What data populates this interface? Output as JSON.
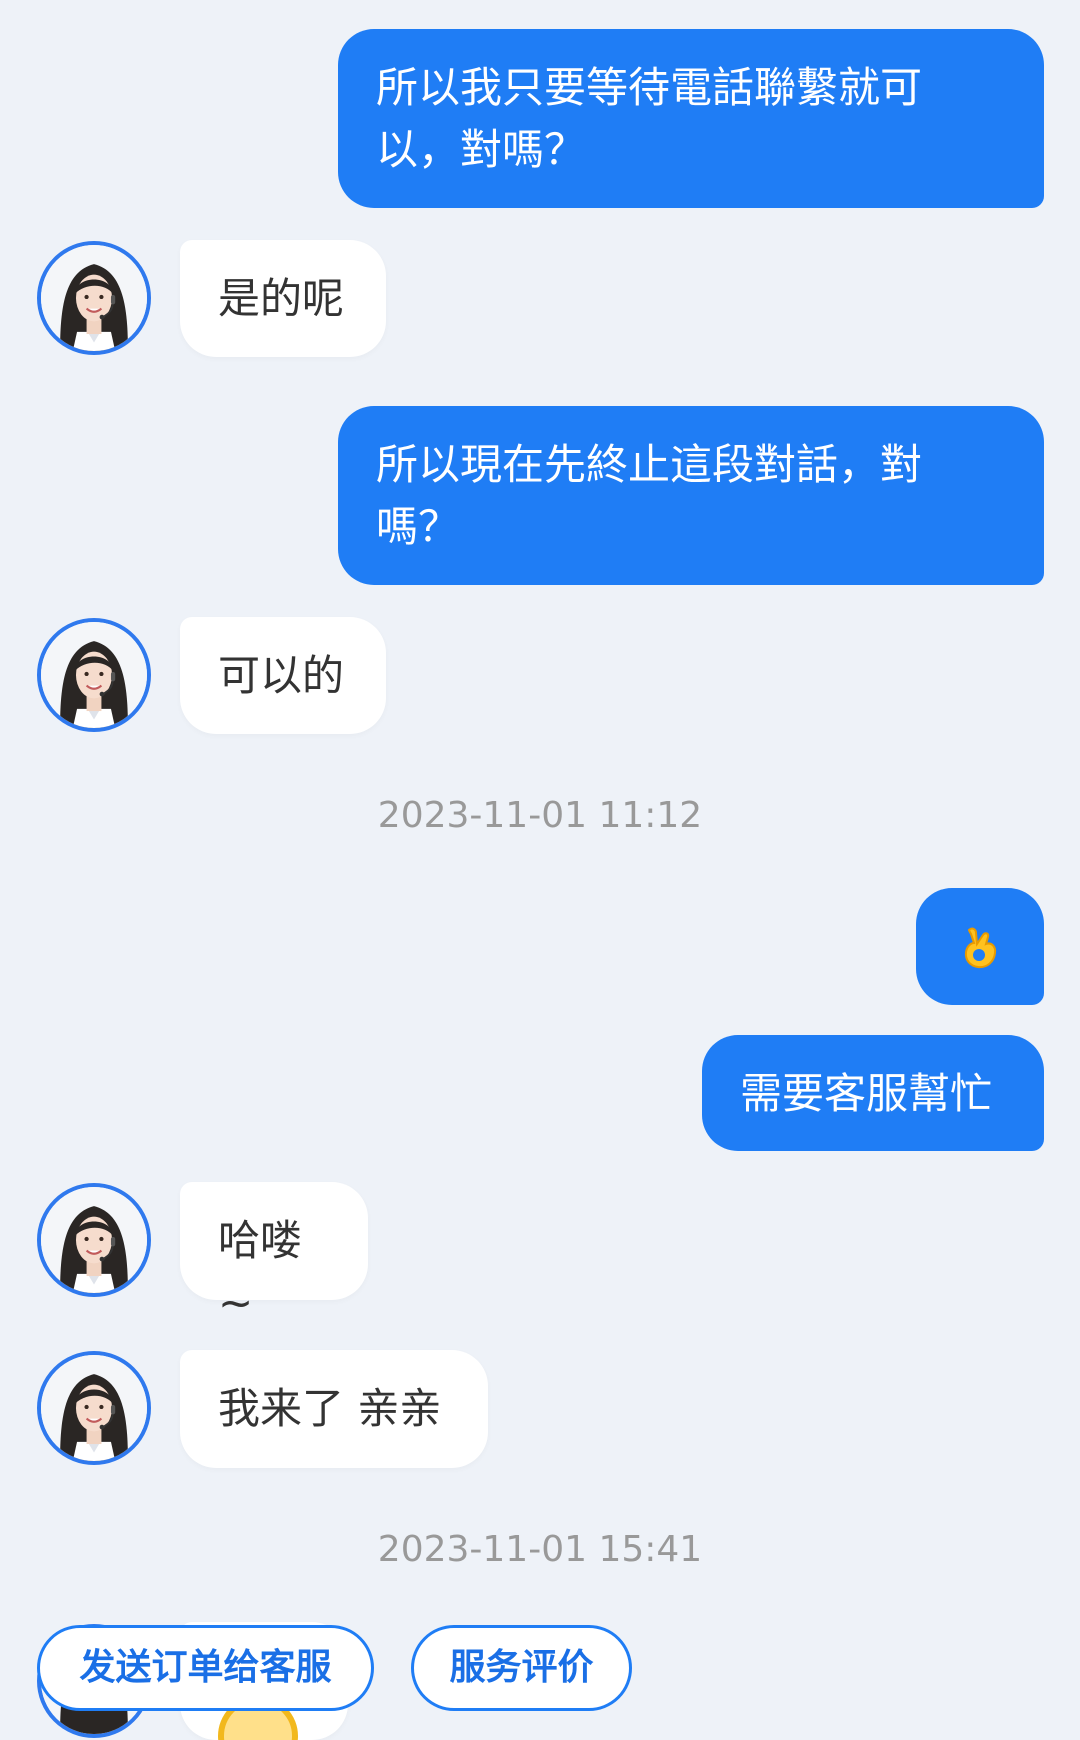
{
  "messages": [
    {
      "dir": "out",
      "text": "所以我只要等待電話聯繫就可以，對嗎？"
    },
    {
      "dir": "in",
      "text": "是的呢"
    },
    {
      "dir": "out",
      "text": "所以現在先終止這段對話，對嗎？"
    },
    {
      "dir": "in",
      "text": "可以的"
    },
    {
      "dir": "out",
      "icon": "ok-hand-emoji-icon"
    },
    {
      "dir": "out",
      "text": "需要客服幫忙"
    },
    {
      "dir": "in",
      "text": "哈喽~"
    },
    {
      "dir": "in",
      "text": "我来了 亲亲"
    }
  ],
  "timestamps": [
    "2023-11-01 11:12",
    "2023-11-01 15:41"
  ],
  "quick_actions": [
    "发送订单给客服",
    "服务评价"
  ],
  "colors": {
    "accent": "#1f7df5",
    "background": "#eef2f8",
    "avatar_ring": "#2f79ee"
  }
}
